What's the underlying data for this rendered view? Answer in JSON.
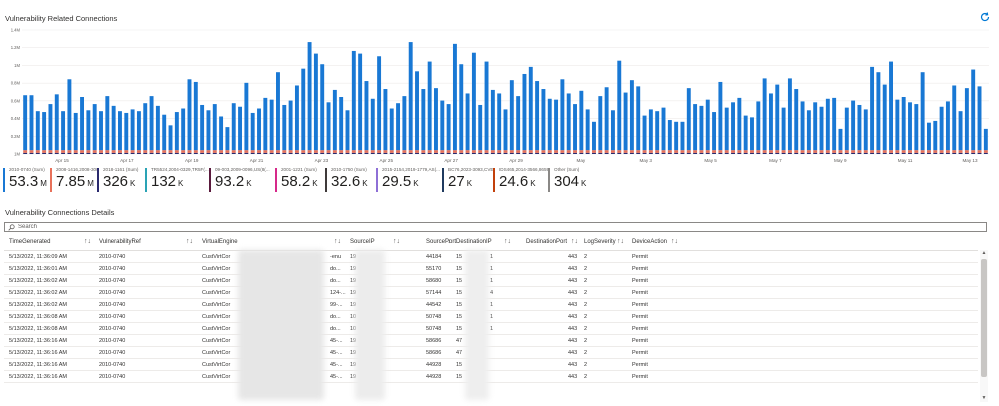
{
  "chart_section": {
    "title": "Vulnerability Related Connections",
    "refresh_icon": "refresh-icon"
  },
  "chart_data": {
    "type": "bar",
    "stacked": true,
    "y_ticks": [
      "1.4M",
      "1.2M",
      "1M",
      "0.8M",
      "0.6M",
      "0.4M",
      "0.2M",
      "1M"
    ],
    "x_ticks": [
      "Apr 15",
      "Apr 17",
      "Apr 19",
      "Apr 21",
      "Apr 23",
      "Apr 25",
      "Apr 27",
      "Apr 29",
      "May",
      "May 3",
      "May 5",
      "May 7",
      "May 9",
      "May 11",
      "May 13"
    ],
    "ylim": [
      0,
      1400000
    ],
    "grid": true,
    "colors": {
      "primary": "#1978d4",
      "secondary": "#e8715a",
      "dark": "#2a2a6e"
    },
    "series": [
      {
        "name": "2010-0740 (Sum)",
        "values": [
          620000,
          620000,
          440000,
          430000,
          520000,
          630000,
          440000,
          800000,
          420000,
          600000,
          450000,
          520000,
          440000,
          610000,
          500000,
          440000,
          420000,
          460000,
          440000,
          530000,
          610000,
          500000,
          400000,
          280000,
          430000,
          470000,
          800000,
          770000,
          510000,
          450000,
          520000,
          380000,
          260000,
          530000,
          490000,
          760000,
          420000,
          470000,
          590000,
          570000,
          880000,
          510000,
          560000,
          730000,
          920000,
          1220000,
          1090000,
          970000,
          540000,
          680000,
          600000,
          450000,
          1120000,
          1090000,
          780000,
          580000,
          1060000,
          690000,
          470000,
          530000,
          610000,
          1220000,
          890000,
          690000,
          1000000,
          700000,
          560000,
          520000,
          1200000,
          970000,
          640000,
          1100000,
          510000,
          1000000,
          680000,
          640000,
          460000,
          790000,
          610000,
          860000,
          940000,
          780000,
          690000,
          580000,
          570000,
          800000,
          640000,
          520000,
          670000,
          460000,
          320000,
          610000,
          710000,
          450000,
          1010000,
          650000,
          790000,
          720000,
          390000,
          460000,
          440000,
          480000,
          340000,
          320000,
          320000,
          700000,
          520000,
          500000,
          570000,
          430000,
          770000,
          480000,
          540000,
          590000,
          390000,
          370000,
          550000,
          810000,
          640000,
          740000,
          480000,
          810000,
          690000,
          550000,
          450000,
          540000,
          490000,
          580000,
          590000,
          240000,
          480000,
          560000,
          510000,
          460000,
          940000,
          880000,
          740000,
          1000000,
          570000,
          600000,
          540000,
          520000,
          880000,
          310000,
          330000,
          490000,
          550000,
          730000,
          440000,
          700000,
          910000,
          720000,
          240000
        ]
      },
      {
        "name": "2008-1416,2008-3008(...",
        "values": [
          30000,
          30000,
          30000,
          30000,
          30000,
          30000,
          30000,
          30000,
          30000,
          30000,
          30000,
          30000,
          30000,
          30000,
          30000,
          30000,
          30000,
          30000,
          30000,
          30000,
          30000,
          30000,
          30000,
          30000,
          30000,
          30000,
          30000,
          30000,
          30000,
          30000,
          30000,
          30000,
          30000,
          30000,
          30000,
          30000,
          30000,
          30000,
          30000,
          30000,
          30000,
          30000,
          30000,
          30000,
          30000,
          30000,
          30000,
          30000,
          30000,
          30000,
          30000,
          30000,
          30000,
          30000,
          30000,
          30000,
          30000,
          30000,
          30000,
          30000,
          30000,
          30000,
          30000,
          30000,
          30000,
          30000,
          30000,
          30000,
          30000,
          30000,
          30000,
          30000,
          30000,
          30000,
          30000,
          30000,
          30000,
          30000,
          30000,
          30000,
          30000,
          30000,
          30000,
          30000,
          30000,
          30000,
          30000,
          30000,
          30000,
          30000,
          30000,
          30000,
          30000,
          30000,
          30000,
          30000,
          30000,
          30000,
          30000,
          30000,
          30000,
          30000,
          30000,
          30000,
          30000,
          30000,
          30000,
          30000,
          30000,
          30000,
          30000,
          30000,
          30000,
          30000,
          30000,
          30000,
          30000,
          30000,
          30000,
          30000,
          30000,
          30000,
          30000,
          30000,
          30000,
          30000,
          30000,
          30000,
          30000,
          30000,
          30000,
          30000,
          30000,
          30000,
          30000,
          30000,
          30000,
          30000,
          30000,
          30000,
          30000,
          30000,
          30000,
          30000,
          30000,
          30000,
          30000,
          30000,
          30000,
          30000,
          30000,
          30000,
          30000
        ]
      }
    ]
  },
  "tiles": [
    {
      "label": "2010-0740 (Sum)",
      "value": "53.3",
      "unit": "M",
      "color": "#1978d4"
    },
    {
      "label": "2008-1416,2008-3008(...",
      "value": "7.85",
      "unit": "M",
      "color": "#e8715a"
    },
    {
      "label": "2018-1161 (Sum)",
      "value": "326",
      "unit": "K",
      "color": "#2a2a6e"
    },
    {
      "label": "TR5524,2004-0329,TR5F(...",
      "value": "132",
      "unit": "K",
      "color": "#2aa3b5"
    },
    {
      "label": "09-003,2009-0096,US(8(...",
      "value": "93.2",
      "unit": "K",
      "color": "#5a1a3d"
    },
    {
      "label": "2001-1221 (Sum)",
      "value": "58.2",
      "unit": "K",
      "color": "#d6298a"
    },
    {
      "label": "2010-1750 (Sum)",
      "value": "32.6",
      "unit": "K",
      "color": "#3f3a3a"
    },
    {
      "label": "2015-2154,2019-1779,AS(...",
      "value": "29.5",
      "unit": "K",
      "color": "#8e6fd6"
    },
    {
      "label": "BC76,2023-3093,CVE4(...",
      "value": "27",
      "unit": "K",
      "color": "#1f3a5f"
    },
    {
      "label": "IDS465,2014-3566,86590(...",
      "value": "24.6",
      "unit": "K",
      "color": "#c2410c"
    },
    {
      "label": "Other (Sum)",
      "value": "304",
      "unit": "K",
      "color": "#8a8886"
    }
  ],
  "details": {
    "title": "Vulnerability Connections Details",
    "search_placeholder": "Search",
    "search_icon": "search-icon",
    "columns": [
      "TimeGenerated",
      "VulnerabilityRef",
      "VirtualEngine",
      "SourceIP",
      "SourcePort",
      "DestinationIP",
      "DestinationPort",
      "LogSeverity",
      "DeviceAction"
    ],
    "sort_icon": "↑↓",
    "rows": [
      {
        "time": "5/13/2022, 11:36:09 AM",
        "vref": "2010-0740",
        "engine": "CustVirtCor",
        "frag": "-enu",
        "sip": "19",
        "sport": "44184",
        "dip": "15",
        "dip2": "1",
        "dport": "443",
        "sev": "2",
        "action": "Permit"
      },
      {
        "time": "5/13/2022, 11:36:01 AM",
        "vref": "2010-0740",
        "engine": "CustVirtCor",
        "frag": "do...",
        "sip": "19",
        "sport": "55170",
        "dip": "15",
        "dip2": "1",
        "dport": "443",
        "sev": "2",
        "action": "Permit"
      },
      {
        "time": "5/13/2022, 11:36:02 AM",
        "vref": "2010-0740",
        "engine": "CustVirtCor",
        "frag": "do...",
        "sip": "19",
        "sport": "58680",
        "dip": "15",
        "dip2": "1",
        "dport": "443",
        "sev": "2",
        "action": "Permit"
      },
      {
        "time": "5/13/2022, 11:36:02 AM",
        "vref": "2010-0740",
        "engine": "CustVirtCor",
        "frag": "124-...",
        "sip": "19",
        "sport": "57144",
        "dip": "15",
        "dip2": "4",
        "dport": "443",
        "sev": "2",
        "action": "Permit"
      },
      {
        "time": "5/13/2022, 11:36:02 AM",
        "vref": "2010-0740",
        "engine": "CustVirtCor",
        "frag": "99-...",
        "sip": "19",
        "sport": "44542",
        "dip": "15",
        "dip2": "1",
        "dport": "443",
        "sev": "2",
        "action": "Permit"
      },
      {
        "time": "5/13/2022, 11:36:08 AM",
        "vref": "2010-0740",
        "engine": "CustVirtCor",
        "frag": "do...",
        "sip": "10",
        "sport": "50748",
        "dip": "15",
        "dip2": "1",
        "dport": "443",
        "sev": "2",
        "action": "Permit"
      },
      {
        "time": "5/13/2022, 11:36:08 AM",
        "vref": "2010-0740",
        "engine": "CustVirtCor",
        "frag": "do...",
        "sip": "10",
        "sport": "50748",
        "dip": "15",
        "dip2": "1",
        "dport": "443",
        "sev": "2",
        "action": "Permit"
      },
      {
        "time": "5/13/2022, 11:36:16 AM",
        "vref": "2010-0740",
        "engine": "CustVirtCor",
        "frag": "45-...",
        "sip": "19",
        "sport": "58686",
        "dip": "47",
        "dip2": "",
        "dport": "443",
        "sev": "2",
        "action": "Permit"
      },
      {
        "time": "5/13/2022, 11:36:16 AM",
        "vref": "2010-0740",
        "engine": "CustVirtCor",
        "frag": "45-...",
        "sip": "19",
        "sport": "58686",
        "dip": "47",
        "dip2": "",
        "dport": "443",
        "sev": "2",
        "action": "Permit"
      },
      {
        "time": "5/13/2022, 11:36:16 AM",
        "vref": "2010-0740",
        "engine": "CustVirtCor",
        "frag": "45-...",
        "sip": "19",
        "sport": "44928",
        "dip": "15",
        "dip2": "",
        "dport": "443",
        "sev": "2",
        "action": "Permit"
      },
      {
        "time": "5/13/2022, 11:36:16 AM",
        "vref": "2010-0740",
        "engine": "CustVirtCor",
        "frag": "45-...",
        "sip": "19",
        "sport": "44928",
        "dip": "15",
        "dip2": "",
        "dport": "443",
        "sev": "2",
        "action": "Permit"
      }
    ]
  }
}
